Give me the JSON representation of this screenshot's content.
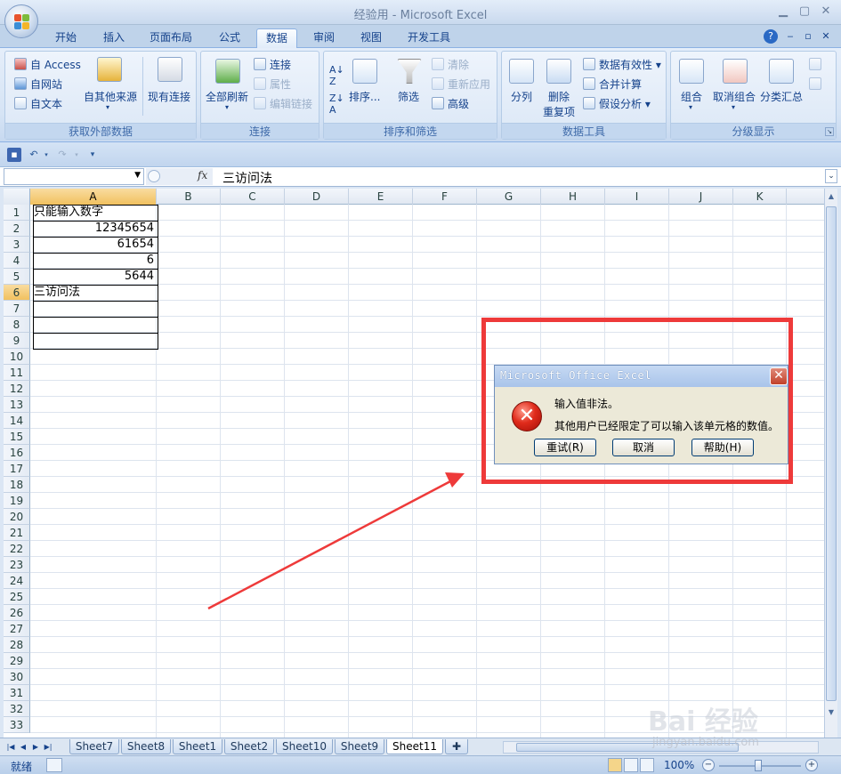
{
  "window": {
    "title": "经验用 - Microsoft Excel"
  },
  "ribbon_tabs": [
    "开始",
    "插入",
    "页面布局",
    "公式",
    "数据",
    "审阅",
    "视图",
    "开发工具"
  ],
  "active_tab": "数据",
  "ribbon": {
    "get_external": {
      "access": "自 Access",
      "web": "自网站",
      "text": "自文本",
      "other_sources": "自其他来源",
      "existing": "现有连接",
      "label": "获取外部数据"
    },
    "connections": {
      "refresh_all": "全部刷新",
      "connections": "连接",
      "properties": "属性",
      "edit_links": "编辑链接",
      "label": "连接"
    },
    "sort_filter": {
      "sort": "排序...",
      "filter": "筛选",
      "clear": "清除",
      "reapply": "重新应用",
      "advanced": "高级",
      "label": "排序和筛选"
    },
    "data_tools": {
      "text_to_columns": "分列",
      "remove_dup_1": "删除",
      "remove_dup_2": "重复项",
      "validation": "数据有效性",
      "consolidate": "合并计算",
      "whatif": "假设分析",
      "label": "数据工具"
    },
    "outline": {
      "group": "组合",
      "ungroup": "取消组合",
      "subtotal": "分类汇总",
      "label": "分级显示"
    }
  },
  "formula_bar": {
    "name_box": "",
    "fx": "fx",
    "value": "三访问法"
  },
  "columns": [
    "A",
    "B",
    "C",
    "D",
    "E",
    "F",
    "G",
    "H",
    "I",
    "J",
    "K"
  ],
  "rows": [
    "1",
    "2",
    "3",
    "4",
    "5",
    "6",
    "7",
    "8",
    "9",
    "10",
    "11",
    "12",
    "13",
    "14",
    "15",
    "16",
    "17",
    "18",
    "19",
    "20",
    "21",
    "22",
    "23",
    "24",
    "25",
    "26",
    "27",
    "28",
    "29",
    "30",
    "31",
    "32",
    "33"
  ],
  "cells": {
    "a1": "只能输入数字",
    "a2": "12345654",
    "a3": "61654",
    "a4": "6",
    "a5": "5644",
    "a6": "三访问法"
  },
  "sheets": [
    "Sheet7",
    "Sheet8",
    "Sheet1",
    "Sheet2",
    "Sheet10",
    "Sheet9",
    "Sheet11"
  ],
  "active_sheet": "Sheet11",
  "status": {
    "ready": "就绪",
    "zoom": "100%"
  },
  "dialog": {
    "title": "Microsoft Office Excel",
    "message1": "输入值非法。",
    "message2": "其他用户已经限定了可以输入该单元格的数值。",
    "retry": "重试(R)",
    "cancel": "取消",
    "help": "帮助(H)"
  },
  "watermark": {
    "brand": "Bai 经验",
    "url": "jingyan.baidu.com"
  },
  "colors": {
    "annotation_red": "#ee3a3a",
    "error_icon_red": "#e02b1b",
    "ribbon_blue": "#15428b"
  }
}
